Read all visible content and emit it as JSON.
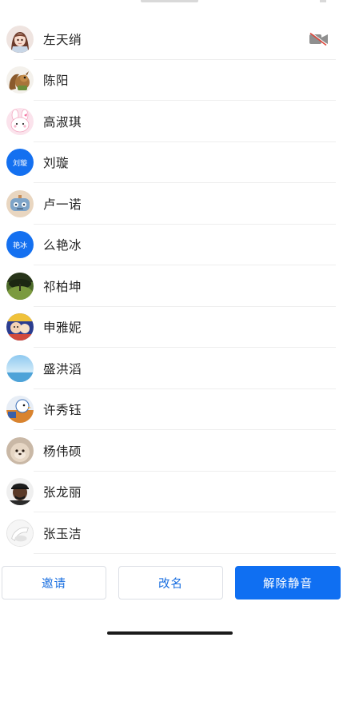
{
  "participants": [
    {
      "name": "左天绡",
      "avatar": "anime-girl-avatar",
      "camera_off": true
    },
    {
      "name": "陈阳",
      "avatar": "squirrel-avatar"
    },
    {
      "name": "高淑琪",
      "avatar": "pink-bunny-avatar"
    },
    {
      "name": "刘璇",
      "avatar_text": "刘璇"
    },
    {
      "name": "卢一诺",
      "avatar": "robot-avatar"
    },
    {
      "name": "么艳冰",
      "avatar_text": "艳冰"
    },
    {
      "name": "祁柏坤",
      "avatar": "green-landscape-avatar"
    },
    {
      "name": "申雅妮",
      "avatar": "colorful-cartoon-avatar"
    },
    {
      "name": "盛洪滔",
      "avatar": "sky-sea-avatar"
    },
    {
      "name": "许秀钰",
      "avatar": "cartoon-bird-avatar"
    },
    {
      "name": "杨伟硕",
      "avatar": "pet-avatar"
    },
    {
      "name": "张龙丽",
      "avatar": "person-cap-avatar"
    },
    {
      "name": "张玉洁",
      "avatar": "white-object-avatar"
    }
  ],
  "icons": {
    "camera_off": "video-off-icon"
  },
  "actions": {
    "invite_label": "邀请",
    "rename_label": "改名",
    "unmute_label": "解除静音"
  },
  "colors": {
    "primary": "#0f6ff2",
    "text_avatar_bg": "#1470f0",
    "outline_text": "#1a6fe0"
  }
}
